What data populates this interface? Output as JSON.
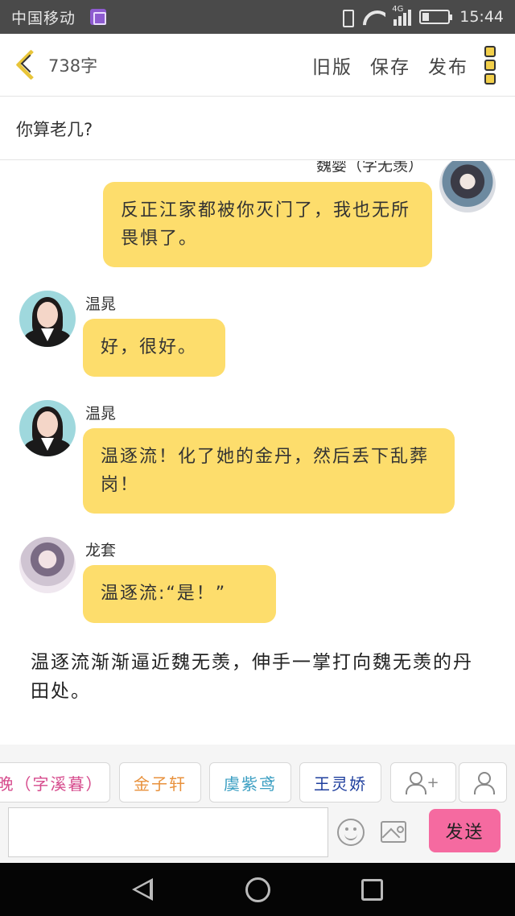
{
  "status_bar": {
    "carrier": "中国移动",
    "network": "4G",
    "time": "15:44",
    "battery_level": 0.25
  },
  "header": {
    "back_icon": "chevron-left-icon",
    "word_count": "738字",
    "actions": [
      "旧版",
      "保存",
      "发布"
    ],
    "menu_icon": "more-vertical-icon"
  },
  "title": "你算老几?",
  "messages": [
    {
      "speaker": "魏婴（字无羡）",
      "side": "right",
      "text": "反正江家都被你灭门了，我也无所畏惧了。"
    },
    {
      "speaker": "温晁",
      "side": "left",
      "text": "好，很好。"
    },
    {
      "speaker": "温晁",
      "side": "left",
      "text": "温逐流！化了她的金丹，然后丢下乱葬岗！"
    },
    {
      "speaker": "龙套",
      "side": "left",
      "text": "温逐流:“是！”"
    }
  ],
  "narration": [
    "温逐流渐渐逼近魏无羡，伸手一掌打向魏无羡的丹田处。"
  ],
  "characters": [
    {
      "label": "晚（字溪暮）",
      "color": "#d64a8c"
    },
    {
      "label": "金子轩",
      "color": "#e8913c"
    },
    {
      "label": "虞紫鸢",
      "color": "#3a9ec2"
    },
    {
      "label": "王灵娇",
      "color": "#1f3f9e"
    }
  ],
  "input": {
    "value": "",
    "placeholder": "",
    "send_label": "发送"
  },
  "colors": {
    "bubble": "#fddd6c",
    "send": "#f56aa0",
    "accent": "#e8c53a"
  }
}
